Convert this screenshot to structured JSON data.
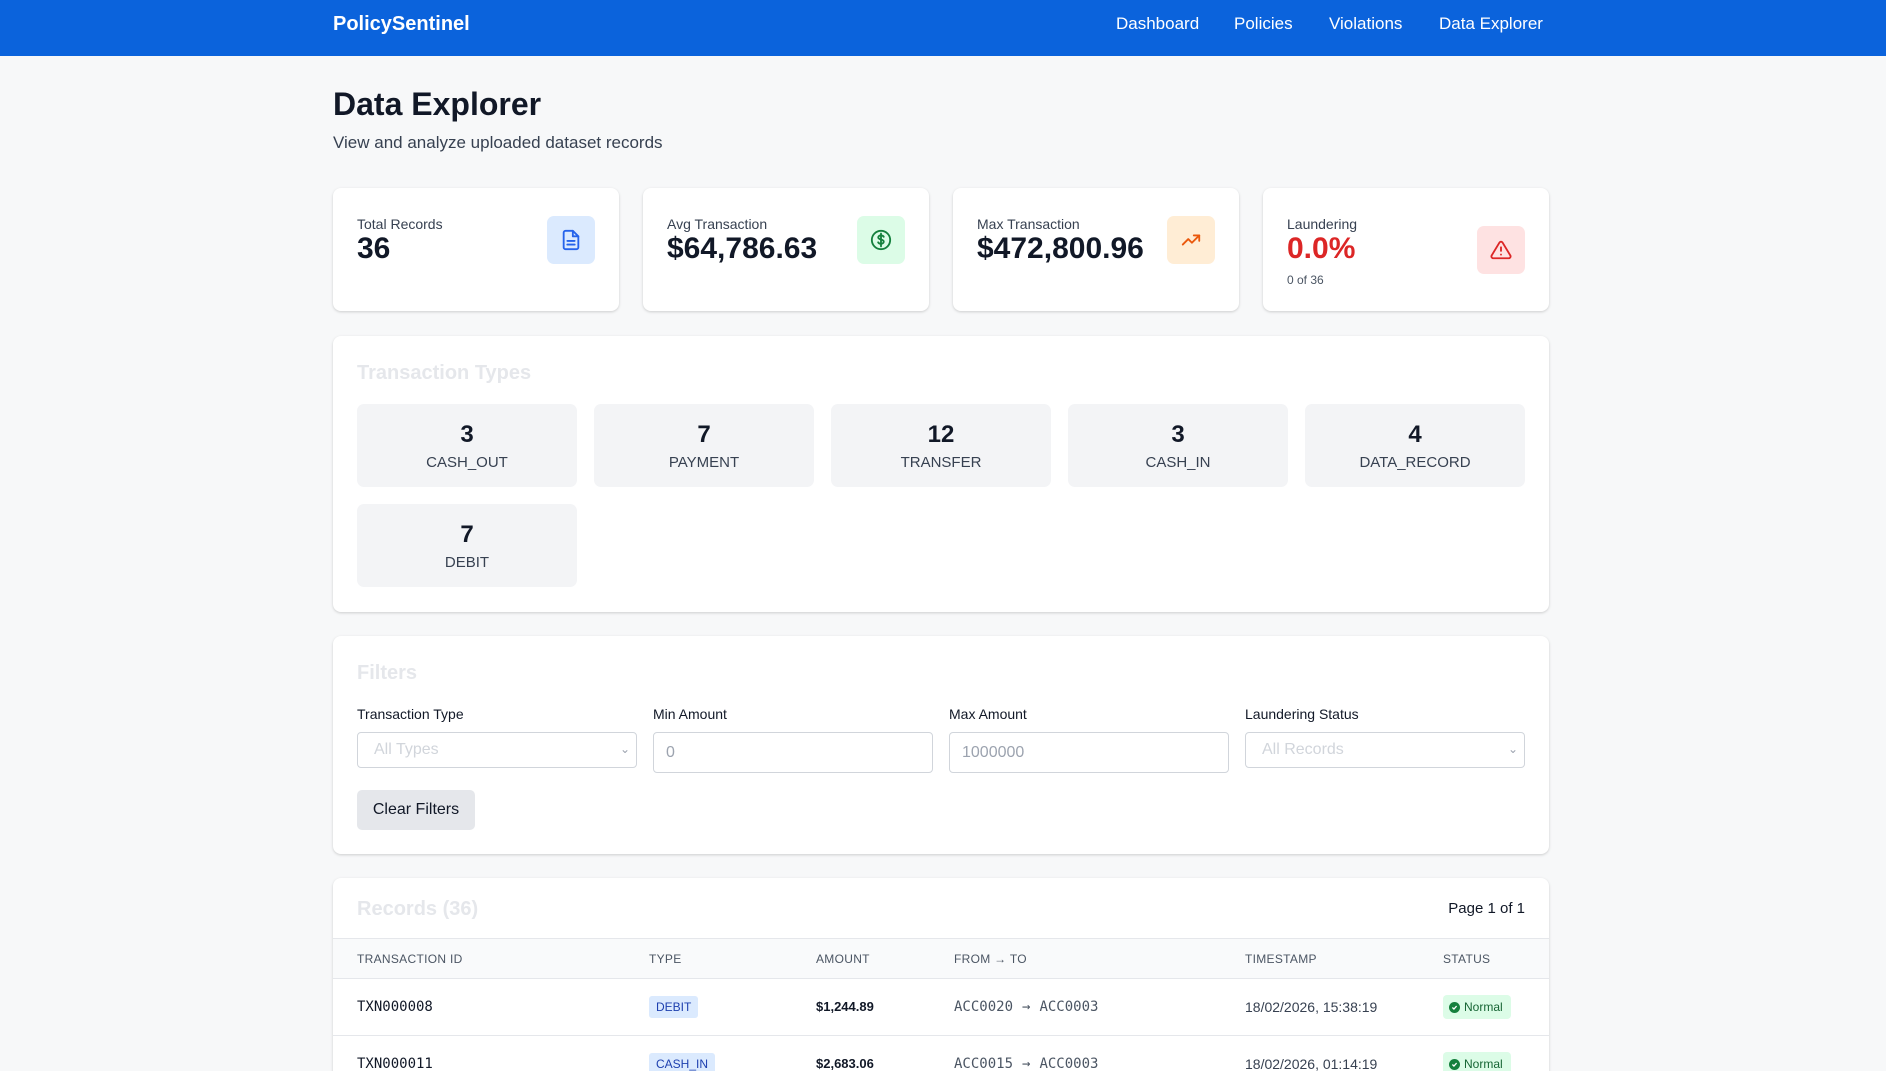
{
  "nav": {
    "brand": "PolicySentinel",
    "links": [
      "Dashboard",
      "Policies",
      "Violations",
      "Data Explorer"
    ]
  },
  "page": {
    "title": "Data Explorer",
    "subtitle": "View and analyze uploaded dataset records"
  },
  "stats": [
    {
      "label": "Total Records",
      "value": "36",
      "icon": "document-icon",
      "icon_bg": "#dbeafe",
      "icon_color": "#2563eb"
    },
    {
      "label": "Avg Transaction",
      "value": "$64,786.63",
      "icon": "dollar-icon",
      "icon_bg": "#dcfce7",
      "icon_color": "#15803d"
    },
    {
      "label": "Max Transaction",
      "value": "$472,800.96",
      "icon": "trending-up-icon",
      "icon_bg": "#ffedd5",
      "icon_color": "#ea580c"
    },
    {
      "label": "Laundering",
      "value": "0.0%",
      "sub": "0 of 36",
      "icon": "alert-triangle-icon",
      "icon_bg": "#fee2e2",
      "icon_color": "#dc2626"
    }
  ],
  "transaction_types": {
    "title": "Transaction Types",
    "items": [
      {
        "count": "3",
        "name": "CASH_OUT"
      },
      {
        "count": "7",
        "name": "PAYMENT"
      },
      {
        "count": "12",
        "name": "TRANSFER"
      },
      {
        "count": "3",
        "name": "CASH_IN"
      },
      {
        "count": "4",
        "name": "DATA_RECORD"
      },
      {
        "count": "7",
        "name": "DEBIT"
      }
    ]
  },
  "filters": {
    "title": "Filters",
    "type_label": "Transaction Type",
    "type_value": "All Types",
    "min_label": "Min Amount",
    "min_placeholder": "0",
    "max_label": "Max Amount",
    "max_placeholder": "1000000",
    "status_label": "Laundering Status",
    "status_value": "All Records",
    "clear_label": "Clear Filters"
  },
  "records": {
    "title": "Records (36)",
    "page_indicator": "Page 1 of 1",
    "columns": [
      "Transaction ID",
      "Type",
      "Amount",
      "From → To",
      "Timestamp",
      "Status"
    ],
    "rows": [
      {
        "id": "TXN000008",
        "type": "DEBIT",
        "amount": "$1,244.89",
        "from": "ACC0020",
        "to": "ACC0003",
        "timestamp": "18/02/2026, 15:38:19",
        "status": "Normal"
      },
      {
        "id": "TXN000011",
        "type": "CASH_IN",
        "amount": "$2,683.06",
        "from": "ACC0015",
        "to": "ACC0003",
        "timestamp": "18/02/2026, 01:14:19",
        "status": "Normal"
      }
    ]
  },
  "colors": {
    "primary": "#0b63dc",
    "danger": "#dc2626",
    "success": "#15803d"
  }
}
